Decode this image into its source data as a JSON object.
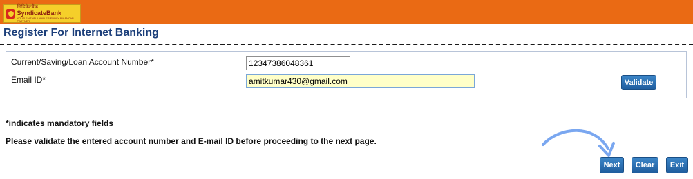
{
  "header": {
    "logo_hindi": "सिंडिकेटबैंक",
    "logo_name": "SyndicateBank",
    "logo_tagline": "YOUR FAITHFUL AND FRIENDLY FINANCIAL PARTNER",
    "brand_color": "#ea6a14"
  },
  "page": {
    "title": "Register For Internet Banking"
  },
  "form": {
    "account_label": "Current/Saving/Loan Account Number*",
    "account_value": "12347386048361",
    "email_label": "Email ID*",
    "email_value": "amitkumar430@gmail.com",
    "validate_label": "Validate"
  },
  "notes": {
    "mandatory": "*indicates mandatory fields",
    "instruction": "Please validate the entered account number and E-mail ID before proceeding to the next page."
  },
  "actions": {
    "next": "Next",
    "clear": "Clear",
    "exit": "Exit"
  },
  "icons": {
    "logo": "syndicate-bank-logo",
    "annotation": "curved-arrow-icon"
  }
}
